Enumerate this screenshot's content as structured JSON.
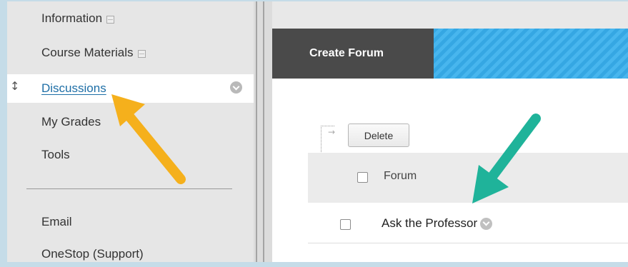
{
  "sidebar": {
    "items": [
      {
        "label": "Information",
        "has_toggle": true
      },
      {
        "label": "Course Materials",
        "has_toggle": true
      },
      {
        "label": "Discussions",
        "active": true
      },
      {
        "label": "My Grades"
      },
      {
        "label": "Tools"
      },
      {
        "label": "Email"
      },
      {
        "label": "OneStop (Support)"
      }
    ]
  },
  "main": {
    "create_forum_label": "Create Forum",
    "delete_label": "Delete",
    "table": {
      "column_header": "Forum",
      "rows": [
        {
          "name": "Ask the Professor"
        }
      ]
    }
  },
  "annotations": {
    "arrow_colors": {
      "orange": "#f5b01c",
      "teal": "#1fb39a"
    }
  },
  "colors": {
    "accent": "#35a7e3",
    "link": "#1d6ea6",
    "create_button": "#4a4a4a"
  }
}
